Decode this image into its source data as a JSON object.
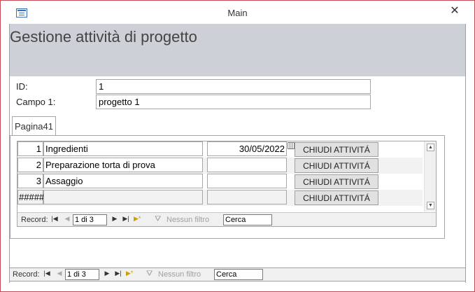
{
  "window": {
    "title": "Main",
    "close_label": "✕"
  },
  "form": {
    "header_title": "Gestione attività di progetto",
    "id_label": "ID:",
    "id_value": "1",
    "campo1_label": "Campo 1:",
    "campo1_value": "progetto 1",
    "tab_label": "Pagina41"
  },
  "subform": {
    "rows": [
      {
        "num": "1",
        "desc": "Ingredienti",
        "date": "30/05/2022",
        "button": "CHIUDI ATTIVITÁ"
      },
      {
        "num": "2",
        "desc": "Preparazione torta di prova",
        "date": "",
        "button": "CHIUDI ATTIVITÁ"
      },
      {
        "num": "3",
        "desc": "Assaggio",
        "date": "",
        "button": "CHIUDI ATTIVITÁ"
      },
      {
        "num": "#####",
        "desc": "",
        "date": "",
        "button": "CHIUDI ATTIVITÁ"
      }
    ],
    "nav": {
      "record_label": "Record:",
      "position": "1 di 3",
      "filter_label": "Nessun filtro",
      "search_value": "Cerca"
    }
  },
  "main_nav": {
    "record_label": "Record:",
    "position": "1 di 3",
    "filter_label": "Nessun filtro",
    "search_value": "Cerca"
  }
}
